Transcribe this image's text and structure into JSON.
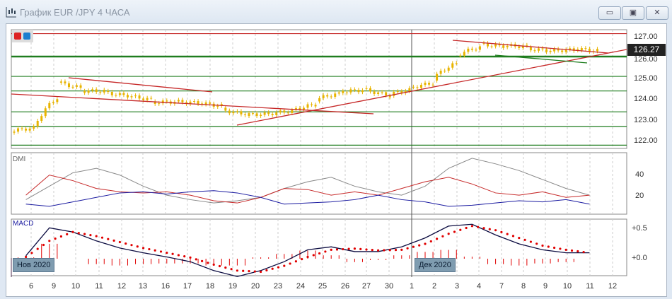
{
  "window": {
    "title": "График EUR /JPY  4 ЧАСА",
    "minimize": "▭",
    "restore": "▣",
    "close": "✕"
  },
  "price_panel": {
    "current_price": "126.27",
    "scale": [
      "127.00",
      "126.00",
      "125.00",
      "124.00",
      "123.00",
      "122.00"
    ]
  },
  "dmi_panel": {
    "label": "DMI",
    "scale": [
      "40",
      "20"
    ]
  },
  "macd_panel": {
    "label": "MACD",
    "scale": [
      "+0.5",
      "+0.0"
    ]
  },
  "month_badges": [
    "Нов 2020",
    "Дек 2020"
  ],
  "colors": {
    "candle": "#e8b400",
    "level": "#1e7d1e",
    "trend": "#c62828",
    "adx": "#888888",
    "plus_di": "#c62828",
    "minus_di": "#1a1aa0",
    "macd": "#0b0b40",
    "signal": "#e00000"
  },
  "chart_data": {
    "type": "line",
    "x_labels": [
      "6",
      "9",
      "10",
      "11",
      "12",
      "13",
      "16",
      "17",
      "18",
      "19",
      "20",
      "23",
      "24",
      "25",
      "26",
      "27",
      "30",
      "1",
      "2",
      "3",
      "4",
      "7",
      "8",
      "9",
      "10",
      "11",
      "12"
    ],
    "price_close": [
      122.7,
      124.8,
      124.4,
      124.4,
      124.1,
      123.9,
      123.9,
      123.8,
      123.6,
      123.2,
      123.3,
      123.5,
      123.9,
      124.4,
      124.5,
      124.1,
      124.6,
      124.9,
      126.1,
      126.7,
      126.5,
      126.5,
      126.3,
      126.4,
      126.27
    ],
    "levels": [
      127.15,
      126.05,
      125.1,
      124.4,
      123.4,
      122.7,
      121.8
    ],
    "adx": [
      18,
      30,
      42,
      46,
      40,
      30,
      22,
      18,
      15,
      17,
      20,
      28,
      34,
      38,
      30,
      25,
      22,
      30,
      46,
      55,
      50,
      44,
      36,
      28,
      22
    ],
    "plus_di": [
      22,
      40,
      35,
      28,
      25,
      24,
      25,
      22,
      17,
      15,
      20,
      28,
      27,
      22,
      25,
      22,
      28,
      34,
      38,
      32,
      24,
      22,
      25,
      20,
      22
    ],
    "minus_di": [
      14,
      12,
      16,
      20,
      24,
      25,
      23,
      25,
      26,
      24,
      20,
      14,
      15,
      16,
      18,
      22,
      18,
      16,
      12,
      13,
      15,
      17,
      16,
      18,
      14
    ],
    "macd": [
      0.05,
      0.52,
      0.45,
      0.3,
      0.18,
      0.1,
      0.03,
      -0.05,
      -0.2,
      -0.3,
      -0.2,
      -0.05,
      0.15,
      0.2,
      0.12,
      0.12,
      0.2,
      0.35,
      0.55,
      0.58,
      0.4,
      0.25,
      0.15,
      0.1,
      0.1
    ],
    "signal": [
      0.03,
      0.3,
      0.45,
      0.38,
      0.28,
      0.18,
      0.1,
      0.02,
      -0.1,
      -0.2,
      -0.22,
      -0.12,
      0.03,
      0.15,
      0.17,
      0.14,
      0.15,
      0.25,
      0.42,
      0.55,
      0.48,
      0.35,
      0.22,
      0.15,
      0.1
    ]
  }
}
